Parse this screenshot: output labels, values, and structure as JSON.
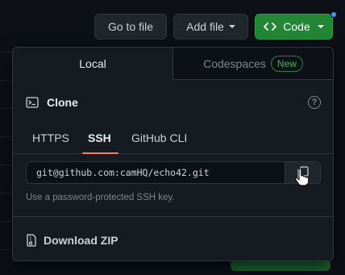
{
  "toolbar": {
    "go_to_file": "Go to file",
    "add_file": "Add file",
    "code": "Code"
  },
  "panel": {
    "tabs": [
      {
        "label": "Local",
        "active": true
      },
      {
        "label": "Codespaces",
        "badge": "New",
        "active": false
      }
    ],
    "clone": {
      "title": "Clone",
      "help_icon": "question-icon",
      "protocols": [
        {
          "label": "HTTPS",
          "active": false
        },
        {
          "label": "SSH",
          "active": true
        },
        {
          "label": "GitHub CLI",
          "active": false
        }
      ],
      "url": "git@github.com:camHQ/echo42.git",
      "hint": "Use a password-protected SSH key.",
      "copy_icon": "copy-icon"
    },
    "download_zip": "Download ZIP"
  },
  "colors": {
    "accent_green": "#238636",
    "underline": "#f78166",
    "badge_green": "#3fb950",
    "panel_bg": "#161b22"
  }
}
